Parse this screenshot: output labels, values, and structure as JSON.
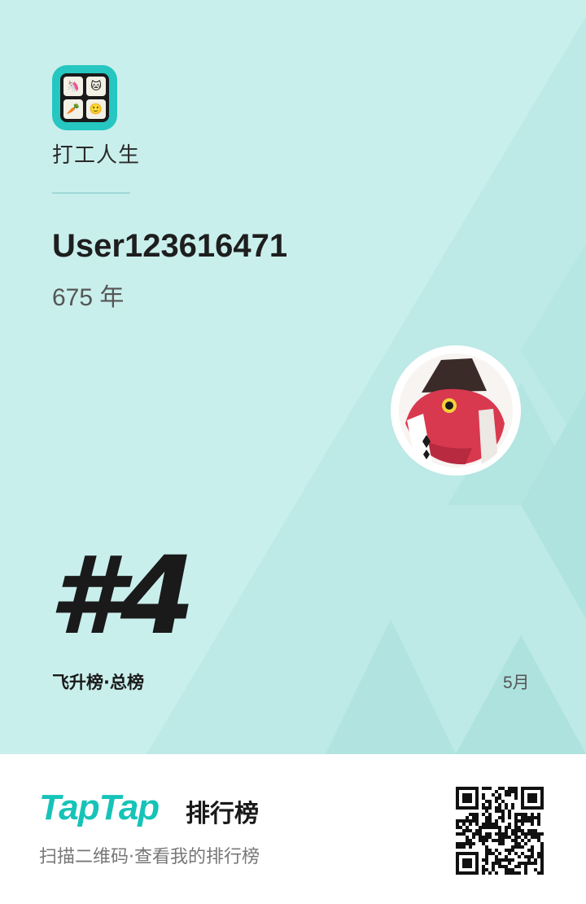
{
  "app": {
    "name": "打工人生",
    "icon": "app-icon-grid"
  },
  "user": {
    "name": "User123616471",
    "years": "675 年",
    "avatar_icon": "fish-character-avatar"
  },
  "rank": {
    "label": "#4",
    "list_name": "飞升榜·总榜",
    "period": "5月"
  },
  "footer": {
    "brand": "TapTap",
    "brand_suffix": "排行榜",
    "hint": "扫描二维码·查看我的排行榜",
    "qr_icon": "qr-code-icon"
  },
  "colors": {
    "card_bg": "#c9efec",
    "brand": "#16c3b8",
    "text": "#1a1a1a"
  }
}
